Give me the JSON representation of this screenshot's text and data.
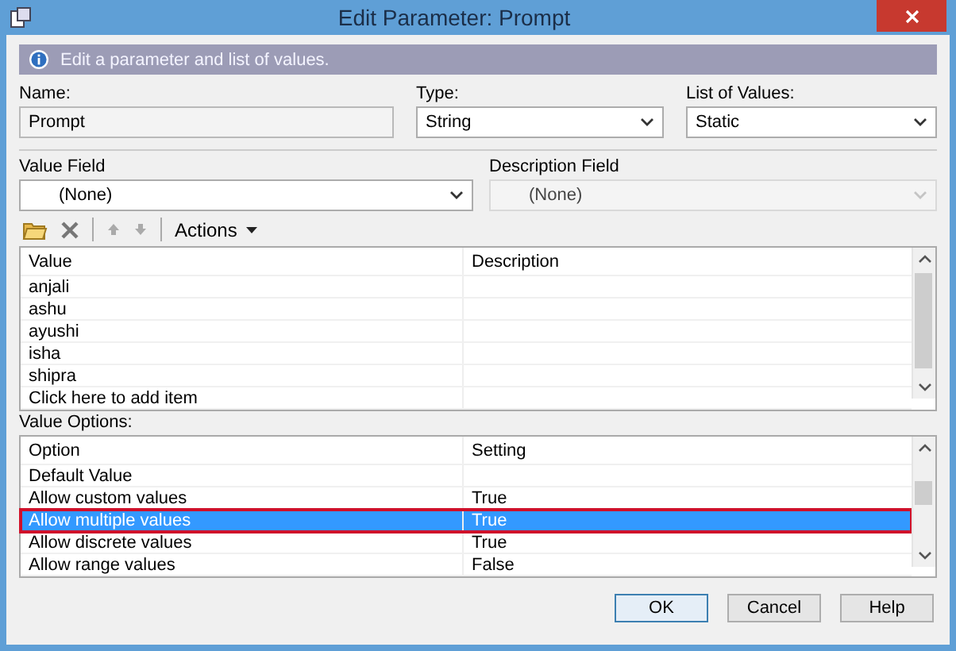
{
  "window": {
    "title": "Edit Parameter: Prompt"
  },
  "info": "Edit a parameter and list of values.",
  "name": {
    "label": "Name:",
    "value": "Prompt"
  },
  "type": {
    "label": "Type:",
    "value": "String"
  },
  "list_of_values": {
    "label": "List of Values:",
    "value": "Static"
  },
  "value_field": {
    "label": "Value Field",
    "value": "(None)",
    "disabled": false
  },
  "description_field": {
    "label": "Description Field",
    "value": "(None)",
    "disabled": true
  },
  "toolbar": {
    "actions": "Actions"
  },
  "values_table": {
    "columns": [
      "Value",
      "Description"
    ],
    "rows": [
      {
        "value": "anjali"
      },
      {
        "value": "ashu"
      },
      {
        "value": "ayushi"
      },
      {
        "value": "isha"
      },
      {
        "value": "shipra"
      }
    ],
    "add_item": "Click here to add item"
  },
  "value_options": {
    "label": "Value Options:",
    "columns": [
      "Option",
      "Setting"
    ],
    "rows": [
      {
        "option": "Default Value",
        "selected": false,
        "highlighted": false
      },
      {
        "option": "Allow custom values",
        "setting": "True",
        "selected": false,
        "highlighted": false
      },
      {
        "option": "Allow multiple values",
        "setting": "True",
        "selected": true,
        "highlighted": true
      },
      {
        "option": "Allow discrete values",
        "setting": "True",
        "selected": false,
        "highlighted": false
      },
      {
        "option": "Allow range values",
        "setting": "False",
        "selected": false,
        "highlighted": false
      }
    ]
  },
  "buttons": [
    {
      "label": "OK",
      "default": true
    },
    {
      "label": "Cancel",
      "default": false
    },
    {
      "label": "Help",
      "default": false
    }
  ]
}
